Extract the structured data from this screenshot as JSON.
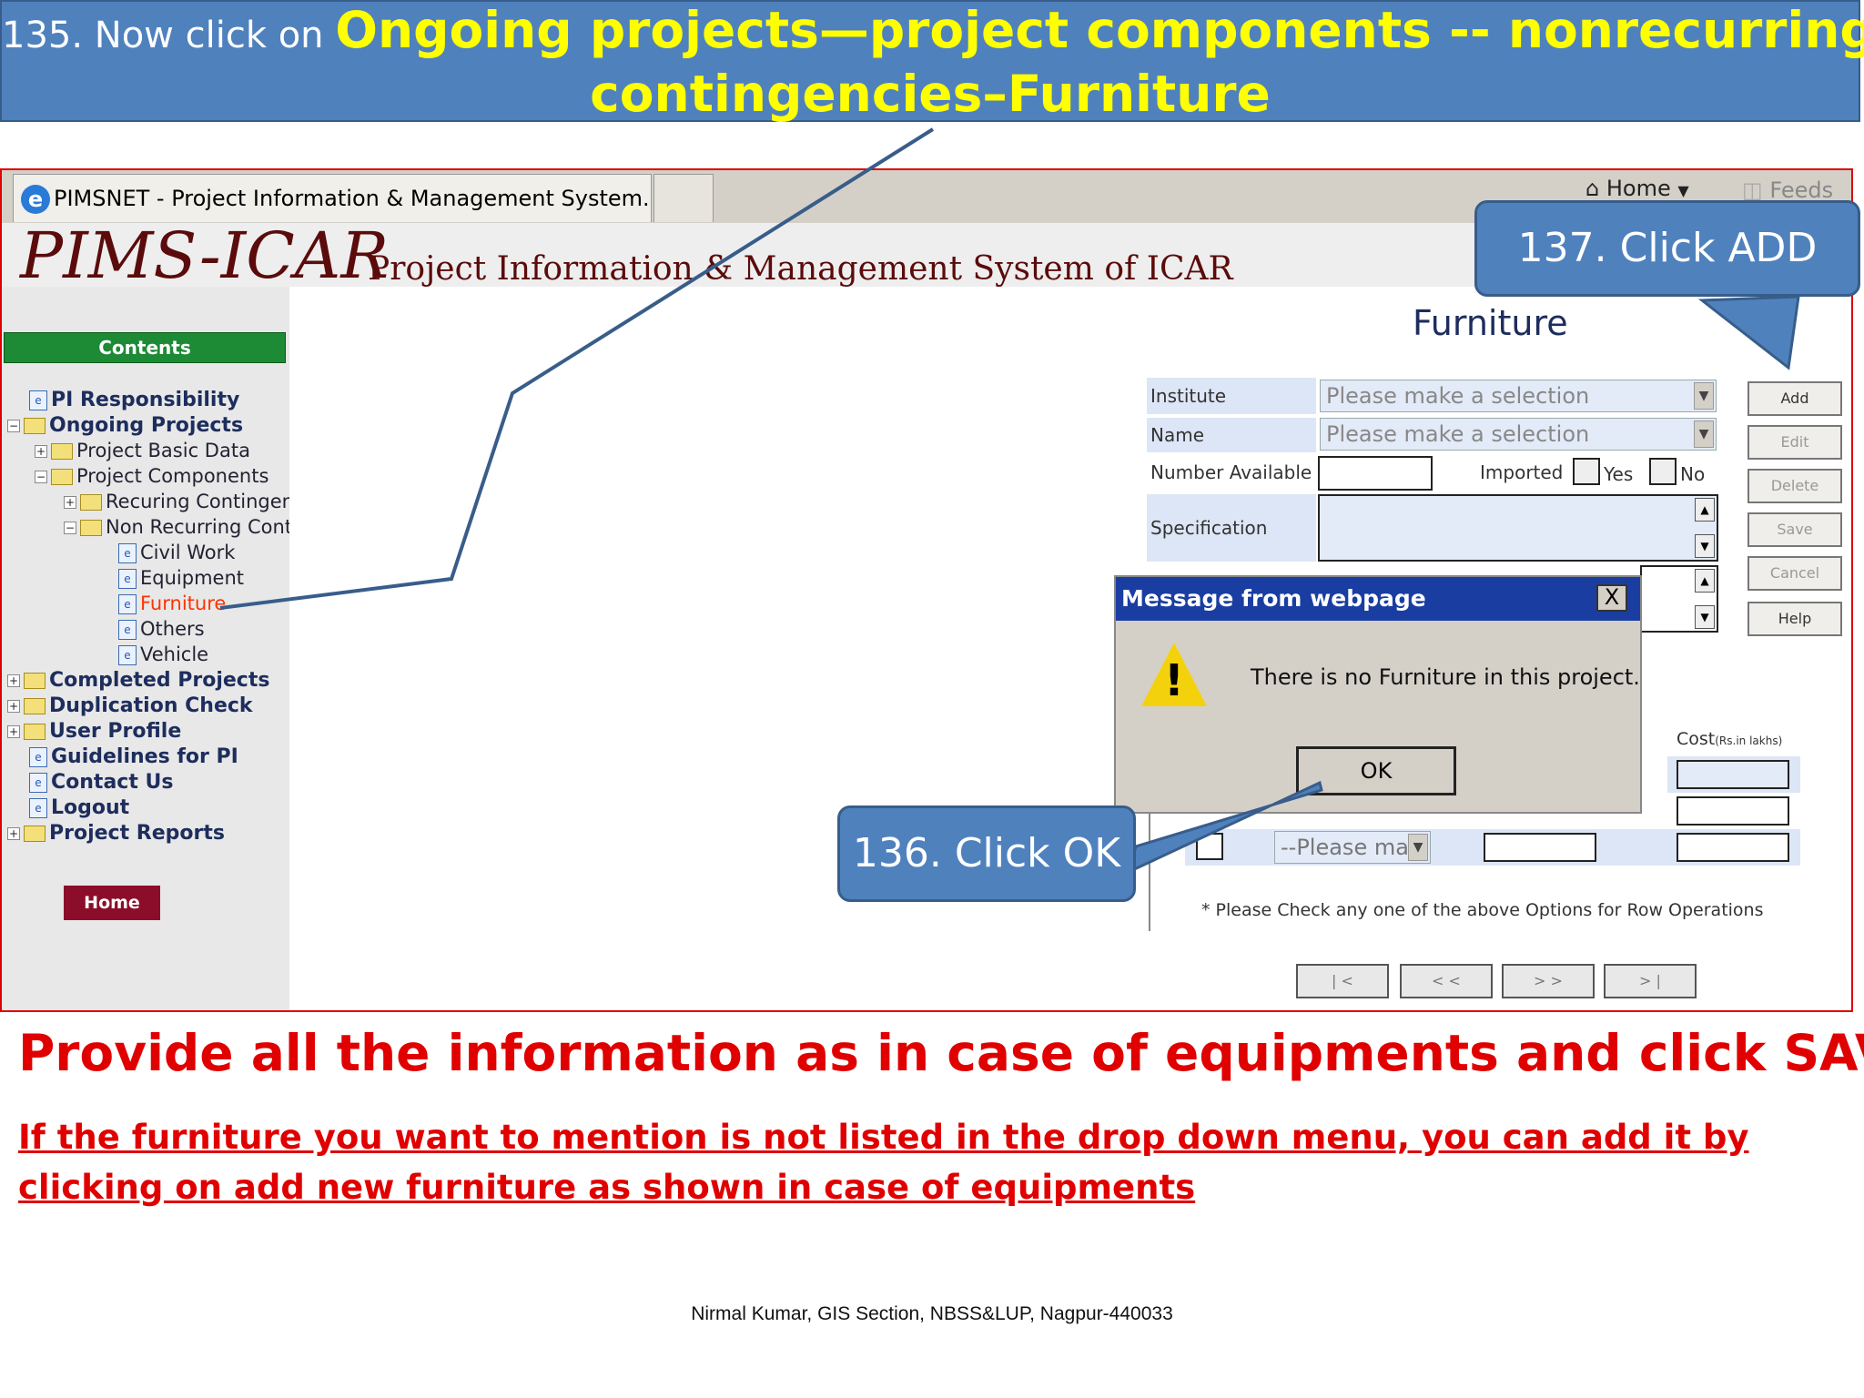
{
  "banner": {
    "prefix": "135. Now click on ",
    "highlight_line1": "Ongoing projects—project components -- nonrecurring",
    "highlight_line2": "contingencies–Furniture"
  },
  "browser": {
    "tab_title": "PIMSNET - Project Information & Management System...",
    "home_label": "Home",
    "feeds_label": "Feeds"
  },
  "site": {
    "logo": "PIMS-ICAR",
    "subtitle": "Project Information & Management System of ICAR"
  },
  "sidebar": {
    "header": "Contents",
    "items": [
      {
        "label": "PI Responsibility"
      },
      {
        "label": "Ongoing Projects"
      },
      {
        "label": "Project Basic Data"
      },
      {
        "label": "Project Components"
      },
      {
        "label": "Recuring Contingen"
      },
      {
        "label": "Non Recurring Cont"
      },
      {
        "label": "Civil Work"
      },
      {
        "label": "Equipment"
      },
      {
        "label": "Furniture"
      },
      {
        "label": "Others"
      },
      {
        "label": "Vehicle"
      },
      {
        "label": "Completed Projects"
      },
      {
        "label": "Duplication Check"
      },
      {
        "label": "User Profile"
      },
      {
        "label": "Guidelines for PI"
      },
      {
        "label": "Contact Us"
      },
      {
        "label": "Logout"
      },
      {
        "label": "Project Reports"
      }
    ],
    "home_button": "Home"
  },
  "form": {
    "title": "Furniture",
    "institute_label": "Institute",
    "institute_value": "Please make a selection",
    "name_label": "Name",
    "name_value": "Please make a selection",
    "number_label": "Number Available",
    "imported_label": "Imported",
    "yes_label": "Yes",
    "no_label": "No",
    "spec_label": "Specification",
    "cost_label": "Cost",
    "cost_unit": "(Rs.in lakhs)",
    "row_select": "--Please mak",
    "row_note": "* Please Check any one of the above Options for Row Operations",
    "buttons": {
      "add": "Add",
      "edit": "Edit",
      "delete": "Delete",
      "save": "Save",
      "cancel": "Cancel",
      "help": "Help"
    },
    "nav": {
      "first": "| <",
      "prev": "< <",
      "next": "> >",
      "last": "> |"
    }
  },
  "dialog": {
    "title": "Message from webpage",
    "message": "There is no Furniture in this project.",
    "ok": "OK",
    "close": "X"
  },
  "callouts": {
    "ok": "136. Click OK",
    "add": "137. Click ADD"
  },
  "instructions": {
    "main": "Provide all the information as in case of equipments and click SAVE",
    "note": "If the furniture you want to mention is not listed in the drop down menu, you can add it by clicking on add new furniture as shown in case of equipments"
  },
  "footer": "Nirmal Kumar, GIS Section, NBSS&LUP, Nagpur-440033",
  "colors": {
    "banner": "#4f81bd",
    "highlight": "#ffff00",
    "instruction": "#e00000",
    "dialog_title": "#1a3da1"
  }
}
